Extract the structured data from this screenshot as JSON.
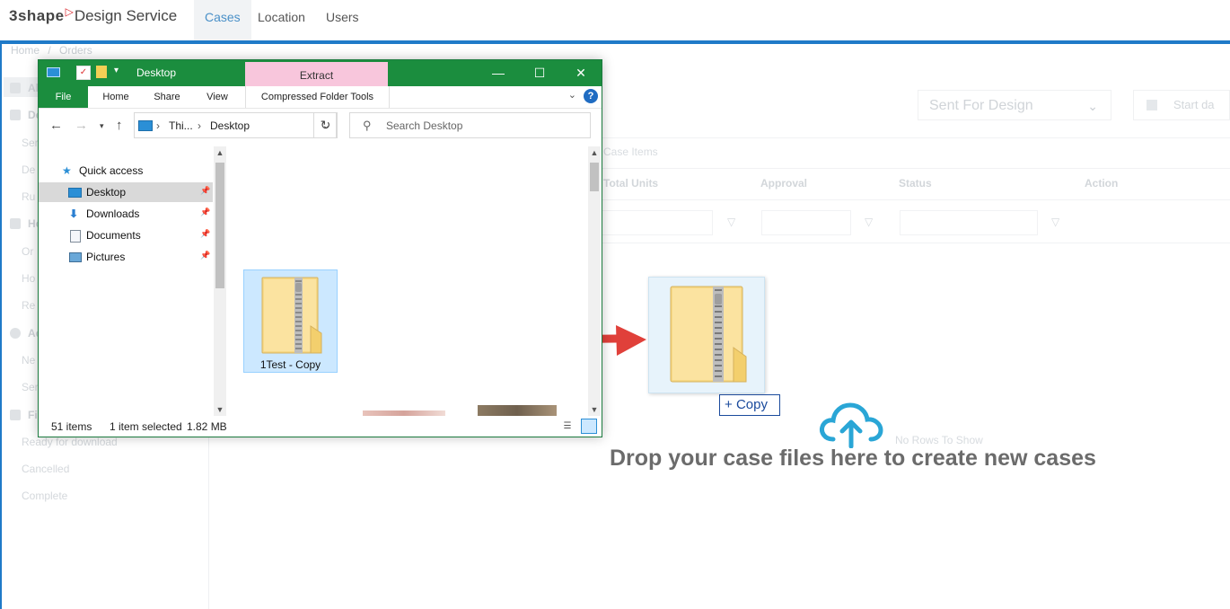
{
  "app": {
    "logo_brand": "3shape",
    "logo_service": "Design Service",
    "nav_tabs": [
      {
        "label": "Cases",
        "active": true
      },
      {
        "label": "Location",
        "active": false
      },
      {
        "label": "Users",
        "active": false
      }
    ],
    "breadcrumb": {
      "home": "Home",
      "current": "Orders"
    },
    "sidebar": {
      "groups": [
        {
          "label": "All"
        },
        {
          "label": "De"
        },
        {
          "label": "Ho"
        },
        {
          "label": "Ac"
        },
        {
          "label": "Fi"
        }
      ],
      "items": [
        "Ser",
        "De",
        "Ru",
        "Or",
        "Ho",
        "Re",
        "Ne",
        "Ser",
        "Ready for download",
        "Cancelled",
        "Complete"
      ]
    },
    "filter_status": "Sent For Design",
    "date_placeholder": "Start da",
    "grid_breadcrumb": "Case Items",
    "columns": [
      "Total Units",
      "Approval",
      "Status",
      "Action"
    ],
    "no_rows": "No Rows To Show",
    "drop_text": "Drop your case files here to create new cases",
    "accent_color": "#1f7ac8",
    "upload_icon": "cloud-upload-icon"
  },
  "explorer": {
    "title": "Desktop",
    "context_tab": "Extract",
    "ribbon_tabs": [
      "File",
      "Home",
      "Share",
      "View"
    ],
    "context_tool_tab": "Compressed Folder Tools",
    "address": {
      "seg1": "Thi...",
      "seg2": "Desktop"
    },
    "search_placeholder": "Search Desktop",
    "nav": {
      "quick_access": "Quick access",
      "items": [
        {
          "label": "Desktop",
          "icon": "desktop-icon",
          "selected": true
        },
        {
          "label": "Downloads",
          "icon": "download-icon",
          "selected": false
        },
        {
          "label": "Documents",
          "icon": "documents-icon",
          "selected": false
        },
        {
          "label": "Pictures",
          "icon": "pictures-icon",
          "selected": false
        }
      ]
    },
    "selected_file": "1Test - Copy",
    "status": {
      "count": "51 items",
      "selection": "1 item selected",
      "size": "1.82 MB"
    },
    "title_color": "#1b8d3e"
  },
  "drag": {
    "tooltip": "Copy",
    "tooltip_icon": "plus-icon"
  }
}
